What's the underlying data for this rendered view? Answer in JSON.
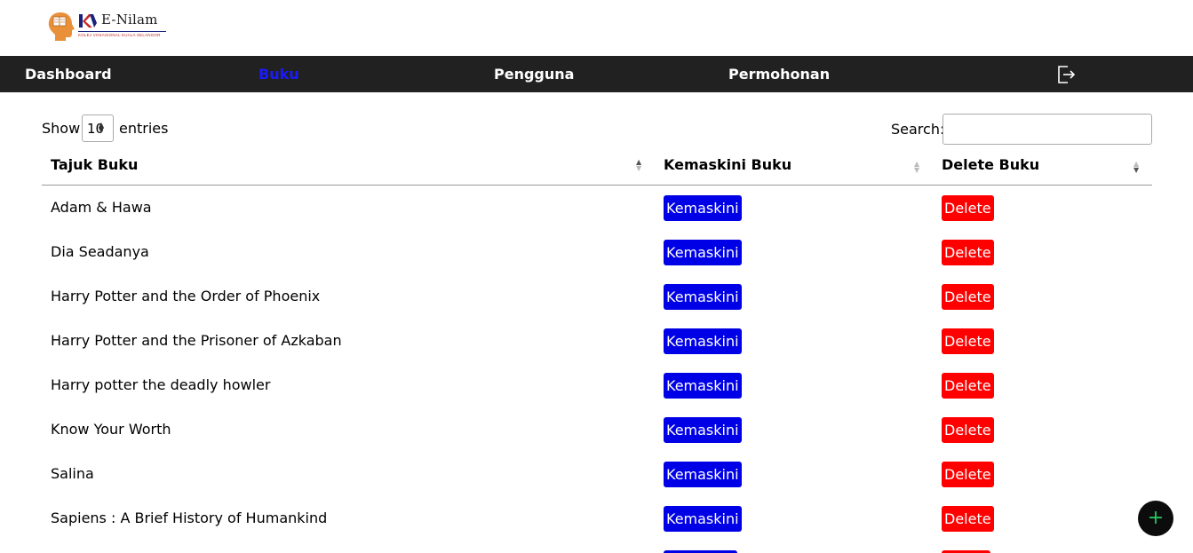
{
  "brand": {
    "title": "E-Nilam",
    "subtitle": "KOLEJ VOKASIONAL KUALA SELANGOR"
  },
  "nav": {
    "items": [
      {
        "label": "Dashboard",
        "active": false
      },
      {
        "label": "Buku",
        "active": true
      },
      {
        "label": "Pengguna",
        "active": false
      },
      {
        "label": "Permohonan",
        "active": false
      }
    ],
    "logout_icon": "logout-icon"
  },
  "table_controls": {
    "show_label": "Show",
    "entries_value": "10",
    "entries_label": "entries",
    "search_label": "Search:",
    "search_value": ""
  },
  "table": {
    "columns": [
      "Tajuk Buku",
      "Kemaskini Buku",
      "Delete Buku"
    ],
    "rows": [
      {
        "title": "Adam & Hawa",
        "edit_label": "Kemaskini",
        "delete_label": "Delete"
      },
      {
        "title": "Dia Seadanya",
        "edit_label": "Kemaskini",
        "delete_label": "Delete"
      },
      {
        "title": "Harry Potter and the Order of Phoenix",
        "edit_label": "Kemaskini",
        "delete_label": "Delete"
      },
      {
        "title": "Harry Potter and the Prisoner of Azkaban",
        "edit_label": "Kemaskini",
        "delete_label": "Delete"
      },
      {
        "title": "Harry potter the deadly howler",
        "edit_label": "Kemaskini",
        "delete_label": "Delete"
      },
      {
        "title": "Know Your Worth",
        "edit_label": "Kemaskini",
        "delete_label": "Delete"
      },
      {
        "title": "Salina",
        "edit_label": "Kemaskini",
        "delete_label": "Delete"
      },
      {
        "title": "Sapiens : A Brief History of Humankind",
        "edit_label": "Kemaskini",
        "delete_label": "Delete"
      }
    ]
  },
  "fab": {
    "label": "+",
    "icon": "plus-icon"
  },
  "colors": {
    "navbar": "#212121",
    "active_nav": "#1a1aff",
    "edit_button": "#0000e6",
    "delete_button": "#ff0000",
    "fab_icon": "#23c45e"
  }
}
